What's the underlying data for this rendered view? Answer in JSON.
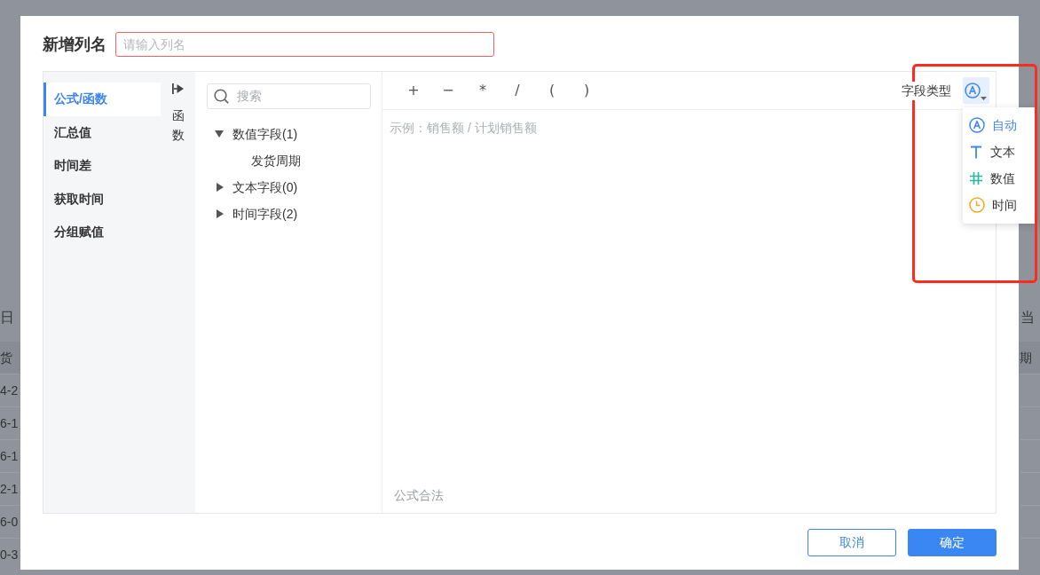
{
  "background": {
    "left": {
      "title": "日",
      "header": "货",
      "rows": [
        "4-2",
        "6-1",
        "6-1",
        "2-1",
        "6-0",
        "0-3"
      ]
    },
    "right": {
      "title": "当",
      "header": "期"
    }
  },
  "dialog": {
    "title": "新增列名",
    "name_field": {
      "placeholder": "请输入列名",
      "invalid": true
    },
    "categories": [
      {
        "label": "公式/函数",
        "selected": true
      },
      {
        "label": "汇总值",
        "selected": false
      },
      {
        "label": "时间差",
        "selected": false
      },
      {
        "label": "获取时间",
        "selected": false
      },
      {
        "label": "分组赋值",
        "selected": false
      }
    ],
    "side_toggle_label": "函数",
    "search": {
      "placeholder": "搜索"
    },
    "field_tree": [
      {
        "label": "数值字段(1)",
        "expanded": true,
        "children": [
          {
            "label": "发货周期"
          }
        ]
      },
      {
        "label": "文本字段(0)",
        "expanded": false
      },
      {
        "label": "时间字段(2)",
        "expanded": false
      }
    ],
    "operators": [
      "+",
      "−",
      "*",
      "/",
      "(",
      ")"
    ],
    "field_type": {
      "label": "字段类型",
      "menu_open": true,
      "options": [
        {
          "kind": "auto",
          "label": "自动",
          "color": "#3d85f0",
          "selected": true
        },
        {
          "kind": "text",
          "label": "文本",
          "color": "#3d85f0",
          "selected": false
        },
        {
          "kind": "number",
          "label": "数值",
          "color": "#2db7a2",
          "selected": false
        },
        {
          "kind": "time",
          "label": "时间",
          "color": "#f5a623",
          "selected": false
        }
      ]
    },
    "formula": {
      "placeholder": "示例：销售额 / 计划销售额",
      "status": "公式合法"
    },
    "buttons": [
      {
        "label": "取消",
        "kind": "secondary"
      },
      {
        "label": "确定",
        "kind": "primary"
      }
    ]
  },
  "highlight_frame": true
}
